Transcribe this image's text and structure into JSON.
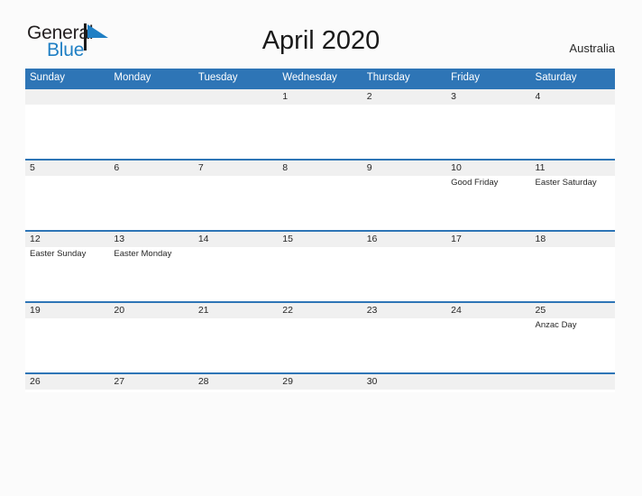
{
  "brand": {
    "name_part_1": "General",
    "name_part_2": "Blue",
    "mark_icon": "flag-triangle-icon",
    "color_dark": "#231f20",
    "color_blue": "#1f7fc4"
  },
  "header": {
    "title": "April 2020",
    "region": "Australia"
  },
  "theme": {
    "header_blue": "#2e75b6",
    "date_band_gray": "#f0f0f0",
    "page_background": "#fbfbfb",
    "text_color": "#262626"
  },
  "calendar": {
    "month": "April",
    "year": "2020",
    "weekday_headers": [
      "Sunday",
      "Monday",
      "Tuesday",
      "Wednesday",
      "Thursday",
      "Friday",
      "Saturday"
    ],
    "weeks": [
      {
        "days": [
          {
            "num": "",
            "event": ""
          },
          {
            "num": "",
            "event": ""
          },
          {
            "num": "",
            "event": ""
          },
          {
            "num": "1",
            "event": ""
          },
          {
            "num": "2",
            "event": ""
          },
          {
            "num": "3",
            "event": ""
          },
          {
            "num": "4",
            "event": ""
          }
        ]
      },
      {
        "days": [
          {
            "num": "5",
            "event": ""
          },
          {
            "num": "6",
            "event": ""
          },
          {
            "num": "7",
            "event": ""
          },
          {
            "num": "8",
            "event": ""
          },
          {
            "num": "9",
            "event": ""
          },
          {
            "num": "10",
            "event": "Good Friday"
          },
          {
            "num": "11",
            "event": "Easter Saturday"
          }
        ]
      },
      {
        "days": [
          {
            "num": "12",
            "event": "Easter Sunday"
          },
          {
            "num": "13",
            "event": "Easter Monday"
          },
          {
            "num": "14",
            "event": ""
          },
          {
            "num": "15",
            "event": ""
          },
          {
            "num": "16",
            "event": ""
          },
          {
            "num": "17",
            "event": ""
          },
          {
            "num": "18",
            "event": ""
          }
        ]
      },
      {
        "days": [
          {
            "num": "19",
            "event": ""
          },
          {
            "num": "20",
            "event": ""
          },
          {
            "num": "21",
            "event": ""
          },
          {
            "num": "22",
            "event": ""
          },
          {
            "num": "23",
            "event": ""
          },
          {
            "num": "24",
            "event": ""
          },
          {
            "num": "25",
            "event": "Anzac Day"
          }
        ]
      },
      {
        "days": [
          {
            "num": "26",
            "event": ""
          },
          {
            "num": "27",
            "event": ""
          },
          {
            "num": "28",
            "event": ""
          },
          {
            "num": "29",
            "event": ""
          },
          {
            "num": "30",
            "event": ""
          },
          {
            "num": "",
            "event": ""
          },
          {
            "num": "",
            "event": ""
          }
        ]
      }
    ]
  }
}
